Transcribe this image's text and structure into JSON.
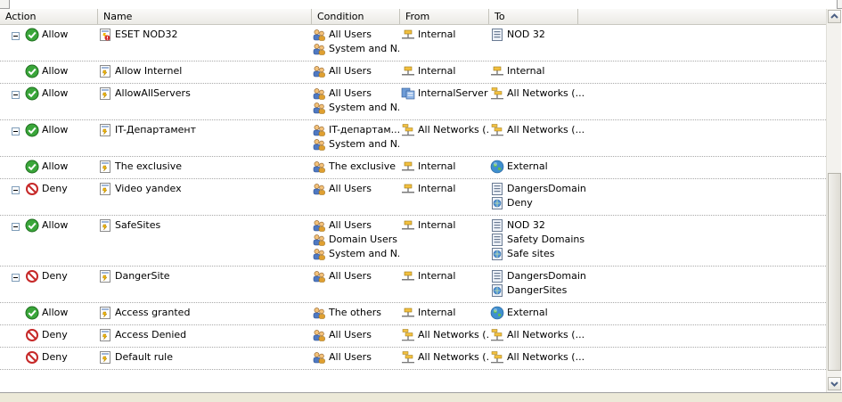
{
  "columns": {
    "action": "Action",
    "name": "Name",
    "condition": "Condition",
    "from": "From",
    "to": "To"
  },
  "rules": [
    {
      "action": "Allow",
      "type": "allow",
      "expand": true,
      "name": "ESET NOD32",
      "name_icon": "rule-bad-icon",
      "condition": [
        "All Users",
        "System and N..."
      ],
      "from": [
        {
          "text": "Internal",
          "icon": "network"
        }
      ],
      "to": [
        {
          "text": "NOD 32",
          "icon": "domain"
        }
      ]
    },
    {
      "action": "Allow",
      "type": "allow",
      "expand": false,
      "name": "Allow Internel",
      "name_icon": "rule-icon",
      "condition": [
        "All Users"
      ],
      "from": [
        {
          "text": "Internal",
          "icon": "network"
        }
      ],
      "to": [
        {
          "text": "Internal",
          "icon": "network"
        }
      ]
    },
    {
      "action": "Allow",
      "type": "allow",
      "expand": true,
      "name": "AllowAllServers",
      "name_icon": "rule-icon",
      "condition": [
        "All Users",
        "System and N..."
      ],
      "from": [
        {
          "text": "InternalServers",
          "icon": "servers"
        }
      ],
      "to": [
        {
          "text": "All Networks (...",
          "icon": "networks"
        }
      ]
    },
    {
      "action": "Allow",
      "type": "allow",
      "expand": true,
      "name": "IT-Департамент",
      "name_icon": "rule-icon",
      "condition": [
        "IT-департам...",
        "System and N..."
      ],
      "from": [
        {
          "text": "All Networks (...",
          "icon": "networks"
        }
      ],
      "to": [
        {
          "text": "All Networks (...",
          "icon": "networks"
        }
      ]
    },
    {
      "action": "Allow",
      "type": "allow",
      "expand": false,
      "name": "The exclusive",
      "name_icon": "rule-icon",
      "condition": [
        "The exclusive"
      ],
      "from": [
        {
          "text": "Internal",
          "icon": "network"
        }
      ],
      "to": [
        {
          "text": "External",
          "icon": "globe"
        }
      ]
    },
    {
      "action": "Deny",
      "type": "deny",
      "expand": true,
      "name": "Video yandex",
      "name_icon": "rule-icon",
      "condition": [
        "All Users"
      ],
      "from": [
        {
          "text": "Internal",
          "icon": "network"
        }
      ],
      "to": [
        {
          "text": "DangersDomain",
          "icon": "domain"
        },
        {
          "text": "Deny",
          "icon": "urlset"
        }
      ]
    },
    {
      "action": "Allow",
      "type": "allow",
      "expand": true,
      "name": "SafeSites",
      "name_icon": "rule-icon",
      "condition": [
        "All Users",
        "Domain Users",
        "System and N..."
      ],
      "from": [
        {
          "text": "Internal",
          "icon": "network"
        }
      ],
      "to": [
        {
          "text": "NOD 32",
          "icon": "domain"
        },
        {
          "text": "Safety Domains",
          "icon": "domain"
        },
        {
          "text": "Safe sites",
          "icon": "urlset"
        }
      ]
    },
    {
      "action": "Deny",
      "type": "deny",
      "expand": true,
      "name": "DangerSite",
      "name_icon": "rule-icon",
      "condition": [
        "All Users"
      ],
      "from": [
        {
          "text": "Internal",
          "icon": "network"
        }
      ],
      "to": [
        {
          "text": "DangersDomain",
          "icon": "domain"
        },
        {
          "text": "DangerSites",
          "icon": "urlset"
        }
      ]
    },
    {
      "action": "Allow",
      "type": "allow",
      "expand": false,
      "name": "Access granted",
      "name_icon": "rule-icon",
      "condition": [
        "The others"
      ],
      "from": [
        {
          "text": "Internal",
          "icon": "network"
        }
      ],
      "to": [
        {
          "text": "External",
          "icon": "globe"
        }
      ]
    },
    {
      "action": "Deny",
      "type": "deny",
      "expand": false,
      "name": "Access Denied",
      "name_icon": "rule-icon",
      "condition": [
        "All Users"
      ],
      "from": [
        {
          "text": "All Networks (...",
          "icon": "networks"
        }
      ],
      "to": [
        {
          "text": "All Networks (...",
          "icon": "networks"
        }
      ]
    },
    {
      "action": "Deny",
      "type": "deny",
      "expand": false,
      "name": "Default rule",
      "name_icon": "rule-icon",
      "condition": [
        "All Users"
      ],
      "from": [
        {
          "text": "All Networks (...",
          "icon": "networks"
        }
      ],
      "to": [
        {
          "text": "All Networks (...",
          "icon": "networks"
        }
      ]
    }
  ],
  "colors": {
    "allow": "#2f9a2f",
    "deny": "#c0392b",
    "separator": "#a9a9a9",
    "header_bg": "#eeede8"
  }
}
